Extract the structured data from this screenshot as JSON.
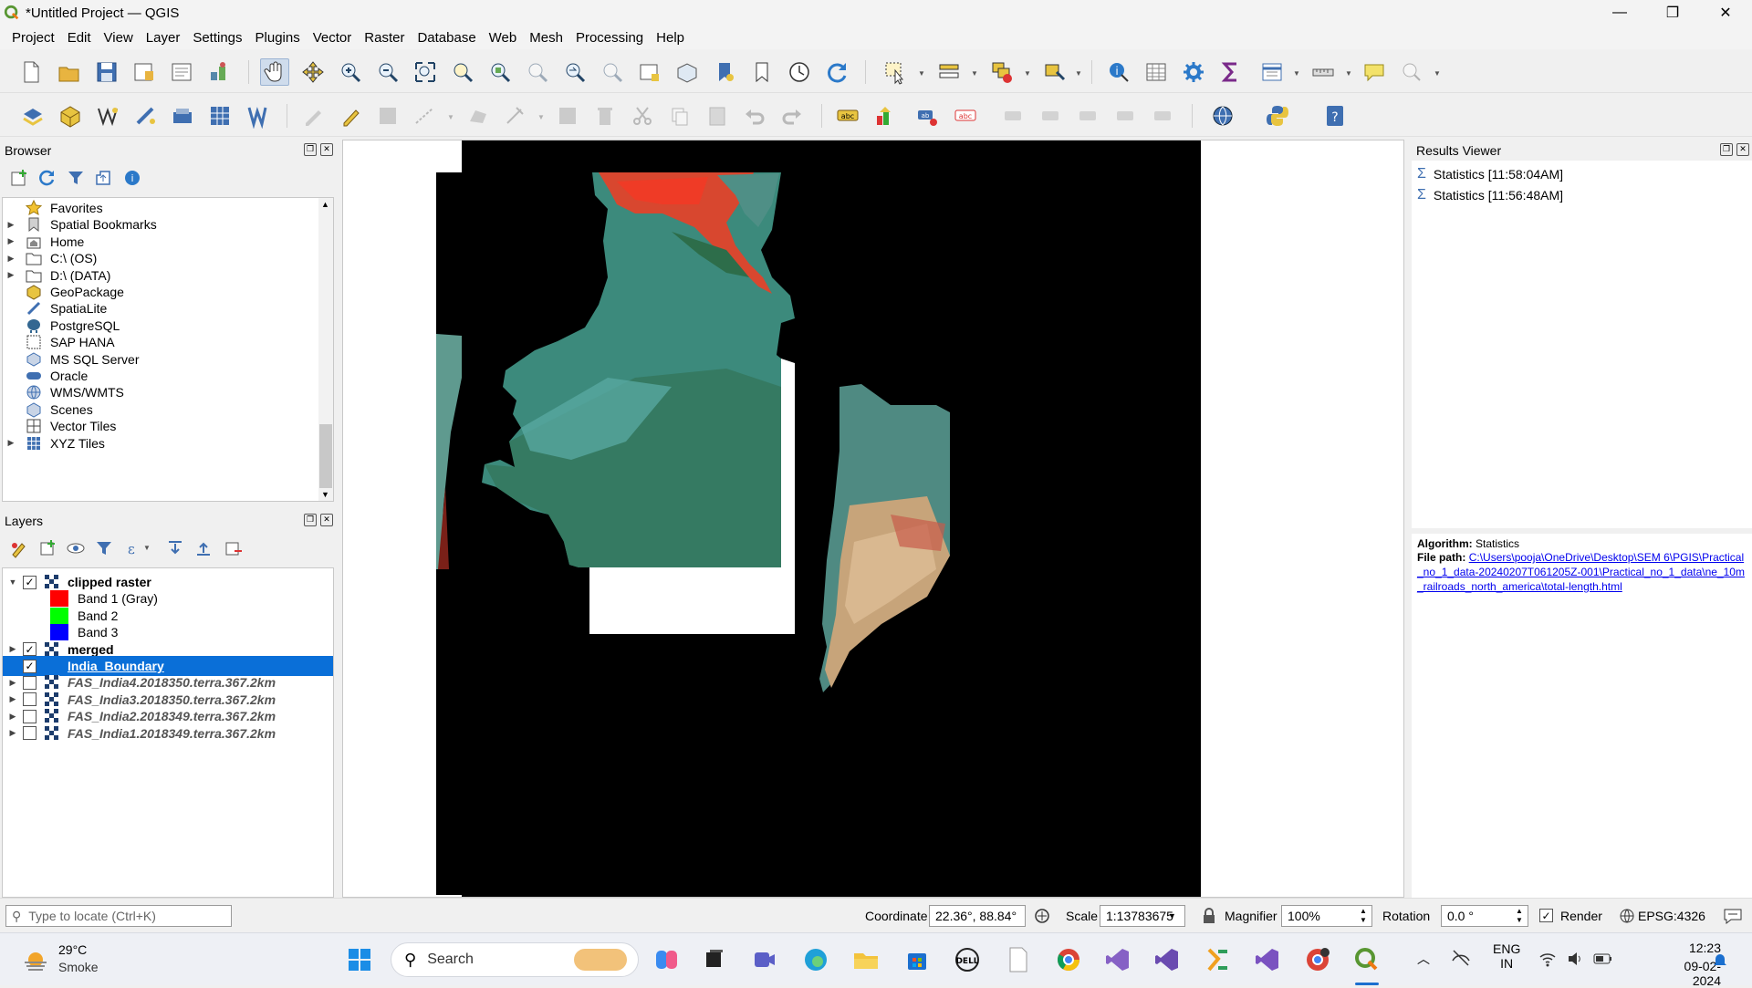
{
  "window": {
    "title": "*Untitled Project — QGIS",
    "minimize": "—",
    "maximize": "❐",
    "close": "✕"
  },
  "menu": [
    "Project",
    "Edit",
    "View",
    "Layer",
    "Settings",
    "Plugins",
    "Vector",
    "Raster",
    "Database",
    "Web",
    "Mesh",
    "Processing",
    "Help"
  ],
  "browser": {
    "title": "Browser",
    "items": [
      {
        "label": "Favorites",
        "icon": "star-icon",
        "expand": false
      },
      {
        "label": "Spatial Bookmarks",
        "icon": "bookmark-icon",
        "expand": true
      },
      {
        "label": "Home",
        "icon": "home-folder-icon",
        "expand": true
      },
      {
        "label": "C:\\ (OS)",
        "icon": "folder-icon",
        "expand": true
      },
      {
        "label": "D:\\ (DATA)",
        "icon": "folder-icon",
        "expand": true
      },
      {
        "label": "GeoPackage",
        "icon": "geopackage-icon",
        "expand": false
      },
      {
        "label": "SpatiaLite",
        "icon": "spatialite-icon",
        "expand": false
      },
      {
        "label": "PostgreSQL",
        "icon": "postgresql-icon",
        "expand": false
      },
      {
        "label": "SAP HANA",
        "icon": "sap-hana-icon",
        "expand": false
      },
      {
        "label": "MS SQL Server",
        "icon": "mssql-icon",
        "expand": false
      },
      {
        "label": "Oracle",
        "icon": "oracle-icon",
        "expand": false
      },
      {
        "label": "WMS/WMTS",
        "icon": "wms-icon",
        "expand": false
      },
      {
        "label": "Scenes",
        "icon": "scenes-icon",
        "expand": false
      },
      {
        "label": "Vector Tiles",
        "icon": "vector-tiles-icon",
        "expand": false
      },
      {
        "label": "XYZ Tiles",
        "icon": "xyz-tiles-icon",
        "expand": true
      }
    ]
  },
  "layers": {
    "title": "Layers",
    "items": [
      {
        "label": "clipped raster",
        "checked": true,
        "bold": true,
        "italic": false,
        "expand": "open",
        "type": "raster"
      },
      {
        "label": "Band 1 (Gray)",
        "swatch": "#ff0000"
      },
      {
        "label": "Band 2",
        "swatch": "#00ff00"
      },
      {
        "label": "Band 3",
        "swatch": "#0000ff"
      },
      {
        "label": "merged",
        "checked": true,
        "bold": true,
        "italic": false,
        "expand": "closed",
        "type": "raster"
      },
      {
        "label": "India_Boundary",
        "checked": true,
        "bold": true,
        "italic": false,
        "expand": "none",
        "type": "vector",
        "selected": true
      },
      {
        "label": "FAS_India4.2018350.terra.367.2km",
        "checked": false,
        "bold": true,
        "italic": true,
        "expand": "closed",
        "type": "raster"
      },
      {
        "label": "FAS_India3.2018350.terra.367.2km",
        "checked": false,
        "bold": true,
        "italic": true,
        "expand": "closed",
        "type": "raster"
      },
      {
        "label": "FAS_India2.2018349.terra.367.2km",
        "checked": false,
        "bold": true,
        "italic": true,
        "expand": "closed",
        "type": "raster"
      },
      {
        "label": "FAS_India1.2018349.terra.367.2km",
        "checked": false,
        "bold": true,
        "italic": true,
        "expand": "closed",
        "type": "raster"
      }
    ]
  },
  "results": {
    "title": "Results Viewer",
    "items": [
      "Statistics [11:58:04AM]",
      "Statistics [11:56:48AM]"
    ],
    "algorithm_label": "Algorithm:",
    "algorithm_value": "Statistics",
    "filepath_label": "File path:",
    "filepath_value": "C:\\Users\\pooja\\OneDrive\\Desktop\\SEM 6\\PGIS\\Practical_no_1_data-20240207T061205Z-001\\Practical_no_1_data\\ne_10m_railroads_north_america\\total-length.html"
  },
  "statusbar": {
    "locate_placeholder": "Type to locate (Ctrl+K)",
    "coordinate_label": "Coordinate",
    "coordinate_value": "22.36°, 88.84°",
    "scale_label": "Scale",
    "scale_value": "1:13783675",
    "magnifier_label": "Magnifier",
    "magnifier_value": "100%",
    "rotation_label": "Rotation",
    "rotation_value": "0.0 °",
    "render_label": "Render",
    "render_checked": true,
    "crs": "EPSG:4326"
  },
  "taskbar": {
    "weather_temp": "29°C",
    "weather_desc": "Smoke",
    "search_label": "Search",
    "lang_top": "ENG",
    "lang_bottom": "IN",
    "time": "12:23",
    "date": "09-02-2024"
  },
  "colors": {
    "selection": "#0a6fd8",
    "qgis_green": "#589632",
    "link": "#0000ee"
  }
}
